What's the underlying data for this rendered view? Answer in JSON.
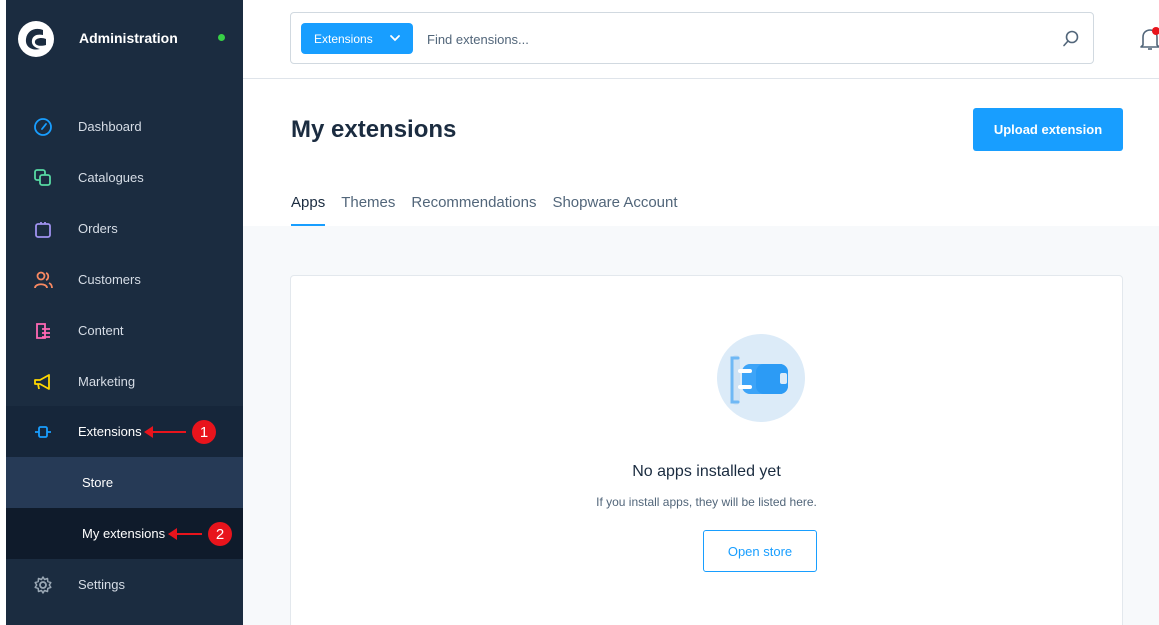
{
  "sidebar": {
    "title": "Administration",
    "items": [
      {
        "label": "Dashboard",
        "icon": "gauge-icon",
        "color": "#189eff"
      },
      {
        "label": "Catalogues",
        "icon": "catalogue-icon",
        "color": "#57d9a3"
      },
      {
        "label": "Orders",
        "icon": "shopping-bag-icon",
        "color": "#a092f0"
      },
      {
        "label": "Customers",
        "icon": "users-icon",
        "color": "#f88962"
      },
      {
        "label": "Content",
        "icon": "content-icon",
        "color": "#ff68b4"
      },
      {
        "label": "Marketing",
        "icon": "megaphone-icon",
        "color": "#ffd700"
      },
      {
        "label": "Extensions",
        "icon": "plug-icon",
        "color": "#189eff"
      },
      {
        "label": "Settings",
        "icon": "gear-icon",
        "color": "#9aa8b5"
      }
    ],
    "sub_items": [
      {
        "label": "Store"
      },
      {
        "label": "My extensions"
      }
    ],
    "annotations": [
      "1",
      "2"
    ]
  },
  "topbar": {
    "scope_label": "Extensions",
    "search_placeholder": "Find extensions..."
  },
  "main": {
    "title": "My extensions",
    "upload_label": "Upload extension",
    "tabs": [
      {
        "label": "Apps",
        "active": true
      },
      {
        "label": "Themes",
        "active": false
      },
      {
        "label": "Recommendations",
        "active": false
      },
      {
        "label": "Shopware Account",
        "active": false
      }
    ],
    "empty_state": {
      "title": "No apps installed yet",
      "subtitle": "If you install apps, they will be listed here.",
      "button_label": "Open store"
    }
  },
  "colors": {
    "sidebar_bg": "#1b2c40",
    "accent": "#189eff",
    "annotation": "#e8141c"
  }
}
